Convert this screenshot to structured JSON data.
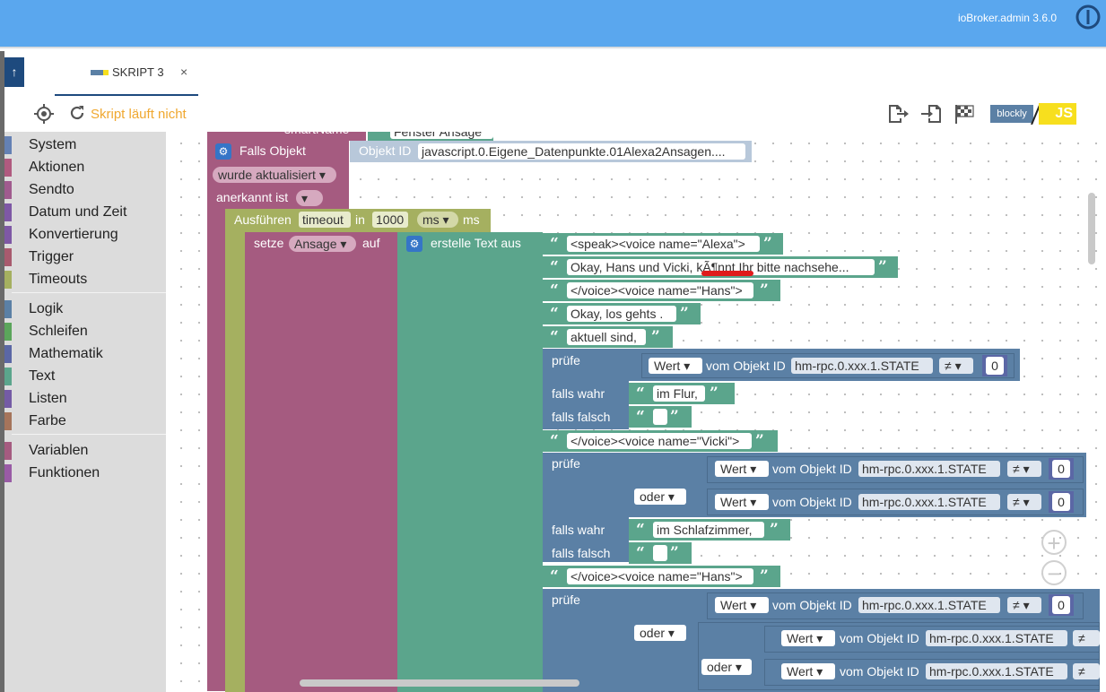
{
  "header": {
    "version": "ioBroker.admin 3.6.0",
    "logo_icon": "iobroker-logo-icon"
  },
  "tab": {
    "label": "SKRIPT 3",
    "close": "×",
    "icon": "blockly-icon"
  },
  "toolbar": {
    "status": "Skript läuft nicht",
    "mode_blockly": "blockly",
    "mode_js": "JS",
    "icons": [
      "target-icon",
      "reload-icon",
      "export-icon",
      "import-icon",
      "flag-icon"
    ]
  },
  "categories": [
    {
      "label": "System",
      "color": "#6481b4"
    },
    {
      "label": "Aktionen",
      "color": "#b05a7f"
    },
    {
      "label": "Sendto",
      "color": "#a05b8e"
    },
    {
      "label": "Datum und Zeit",
      "color": "#7e58a5"
    },
    {
      "label": "Konvertierung",
      "color": "#7e58a5"
    },
    {
      "label": "Trigger",
      "color": "#a85a6e"
    },
    {
      "label": "Timeouts",
      "color": "#a5b060"
    },
    {
      "label": "Logik",
      "color": "#5b80a5"
    },
    {
      "label": "Schleifen",
      "color": "#5ba55b"
    },
    {
      "label": "Mathematik",
      "color": "#5b67a5"
    },
    {
      "label": "Text",
      "color": "#5ba58c"
    },
    {
      "label": "Listen",
      "color": "#745ba5"
    },
    {
      "label": "Farbe",
      "color": "#a5745b"
    },
    {
      "label": "Variablen",
      "color": "#a55b80"
    },
    {
      "label": "Funktionen",
      "color": "#995ba5"
    }
  ],
  "blocks": {
    "top_cut_left": "smartName",
    "top_cut_right": "Fenster Ansage",
    "falls_objekt": "Falls Objekt",
    "objekt_id_label": "Objekt ID",
    "objekt_id_value": "javascript.0.Eigene_Datenpunkte.01Alexa2Ansagen....",
    "wurde": "wurde aktualisiert",
    "anerkannt": "anerkannt ist",
    "ausfuehren": "Ausführen",
    "timeout": "timeout",
    "in": "in",
    "ms_value": "1000",
    "ms_dd": "ms",
    "ms_label": "ms",
    "setze": "setze",
    "var": "Ansage",
    "auf": "auf",
    "erstelle": "erstelle Text aus",
    "texts": [
      "<speak><voice name=\"Alexa\">",
      "Okay, Hans und Vicki, kÃ¶nnt Ihr bitte nachsehe...",
      "</voice><voice name=\"Hans\">",
      "Okay, los gehts .",
      "aktuell sind,",
      "</voice><voice name=\"Vicki\">",
      "</voice><voice name=\"Hans\">"
    ],
    "pruefe": "prüfe",
    "falls_wahr": "falls wahr",
    "falls_falsch": "falls falsch",
    "oder": "oder",
    "wert": "Wert",
    "vom_objekt": "vom Objekt ID",
    "state": "hm-rpc.0.xxx.1.STATE",
    "neq": "≠",
    "zero": "0",
    "im_flur": "im Flur,",
    "im_schlafzimmer": "im Schlafzimmer,"
  },
  "colors": {
    "header": "#5aa7ee",
    "event": "#a55b80",
    "timeout": "#a5b060",
    "text": "#5ba58c",
    "logic": "#5b80a5",
    "math": "#5b67a5"
  }
}
